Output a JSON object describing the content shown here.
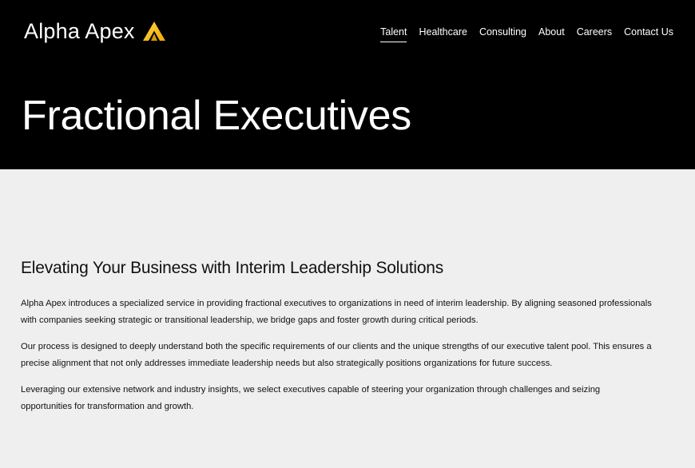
{
  "brand": {
    "name": "Alpha Apex",
    "logo_icon": "chevron-triangle-logo",
    "accent_color": "#f5b60a"
  },
  "nav": {
    "items": [
      {
        "label": "Talent",
        "active": true
      },
      {
        "label": "Healthcare",
        "active": false
      },
      {
        "label": "Consulting",
        "active": false
      },
      {
        "label": "About",
        "active": false
      },
      {
        "label": "Careers",
        "active": false
      },
      {
        "label": "Contact Us",
        "active": false
      }
    ]
  },
  "hero": {
    "title": "Fractional Executives"
  },
  "main": {
    "heading": "Elevating Your Business with Interim Leadership Solutions",
    "paragraphs": [
      "Alpha Apex introduces a specialized service in providing fractional executives to organizations in need of interim leadership. By aligning seasoned professionals with companies seeking strategic or transitional leadership, we bridge gaps and foster growth during critical periods.",
      "Our process is designed to deeply understand both the specific requirements of our clients and the unique strengths of our executive talent pool. This ensures a precise alignment that not only addresses immediate leadership needs but also strategically positions organizations for future success.",
      "Leveraging our extensive network and industry insights, we select executives capable of steering your organization through challenges and seizing opportunities for transformation and growth."
    ]
  },
  "colors": {
    "header_bg": "#000000",
    "body_bg": "#efefef",
    "text": "#111111"
  }
}
